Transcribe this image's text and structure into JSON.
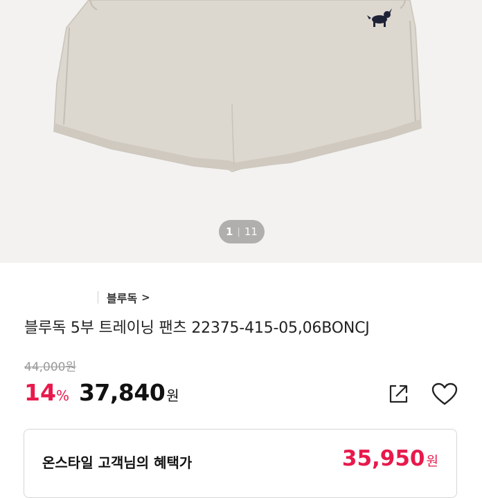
{
  "gallery": {
    "current": "1",
    "separator": "|",
    "total": "11"
  },
  "product": {
    "brand": "블루독",
    "brand_chevron": ">",
    "title": "블루독 5부 트레이닝 팬츠 22375-415-05,06BONCJ",
    "original_price": "44,000원",
    "discount_rate": "14",
    "discount_unit": "%",
    "price": "37,840",
    "currency": "원"
  },
  "benefit": {
    "label": "온스타일 고객님의 혜택가",
    "price": "35,950",
    "currency": "원"
  },
  "icons": {
    "share": "share-icon",
    "wishlist": "heart-icon"
  },
  "colors": {
    "accent": "#e8194c",
    "text": "#111111",
    "muted": "#9a9a9a"
  }
}
